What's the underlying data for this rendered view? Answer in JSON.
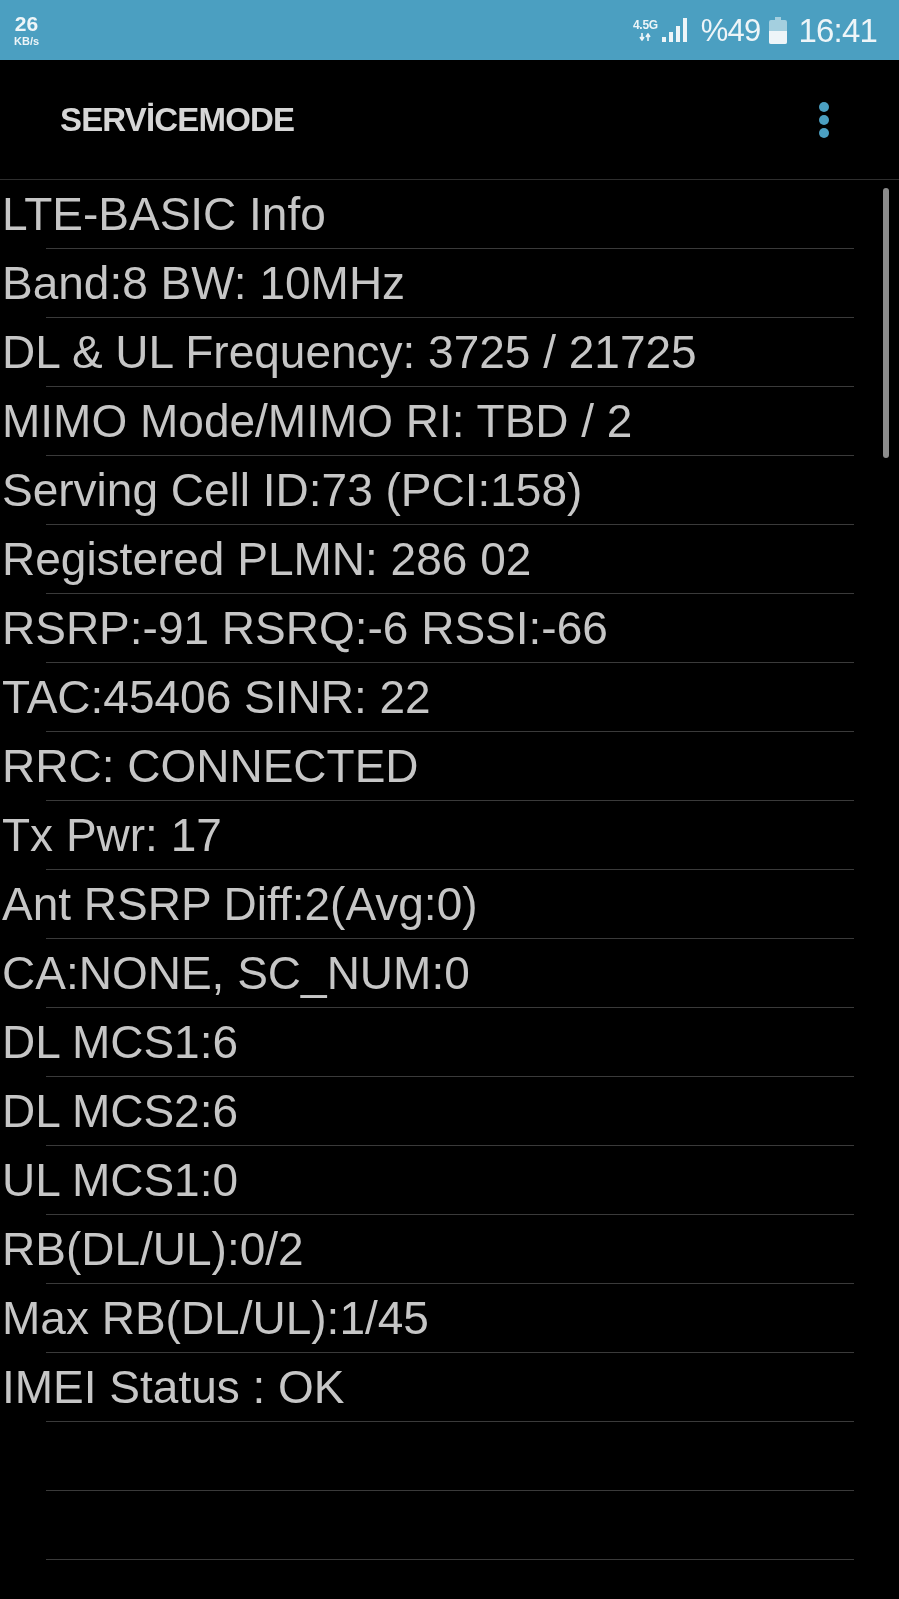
{
  "status_bar": {
    "speed": "26",
    "speed_unit": "KB/s",
    "network": "4.5G",
    "battery": "%49",
    "time": "16:41"
  },
  "app_bar": {
    "title": "SERVİCEMODE"
  },
  "rows": [
    "LTE-BASIC Info",
    "Band:8 BW: 10MHz",
    "DL & UL Frequency: 3725 / 21725",
    "MIMO Mode/MIMO RI: TBD / 2",
    "Serving Cell ID:73 (PCI:158)",
    "Registered PLMN: 286 02",
    "RSRP:-91 RSRQ:-6 RSSI:-66",
    "TAC:45406 SINR: 22",
    "RRC: CONNECTED",
    "Tx Pwr: 17",
    "Ant RSRP Diff:2(Avg:0)",
    "CA:NONE, SC_NUM:0",
    "DL MCS1:6",
    "DL MCS2:6",
    "UL MCS1:0",
    "RB(DL/UL):0/2",
    "Max RB(DL/UL):1/45",
    "IMEI Status : OK"
  ]
}
